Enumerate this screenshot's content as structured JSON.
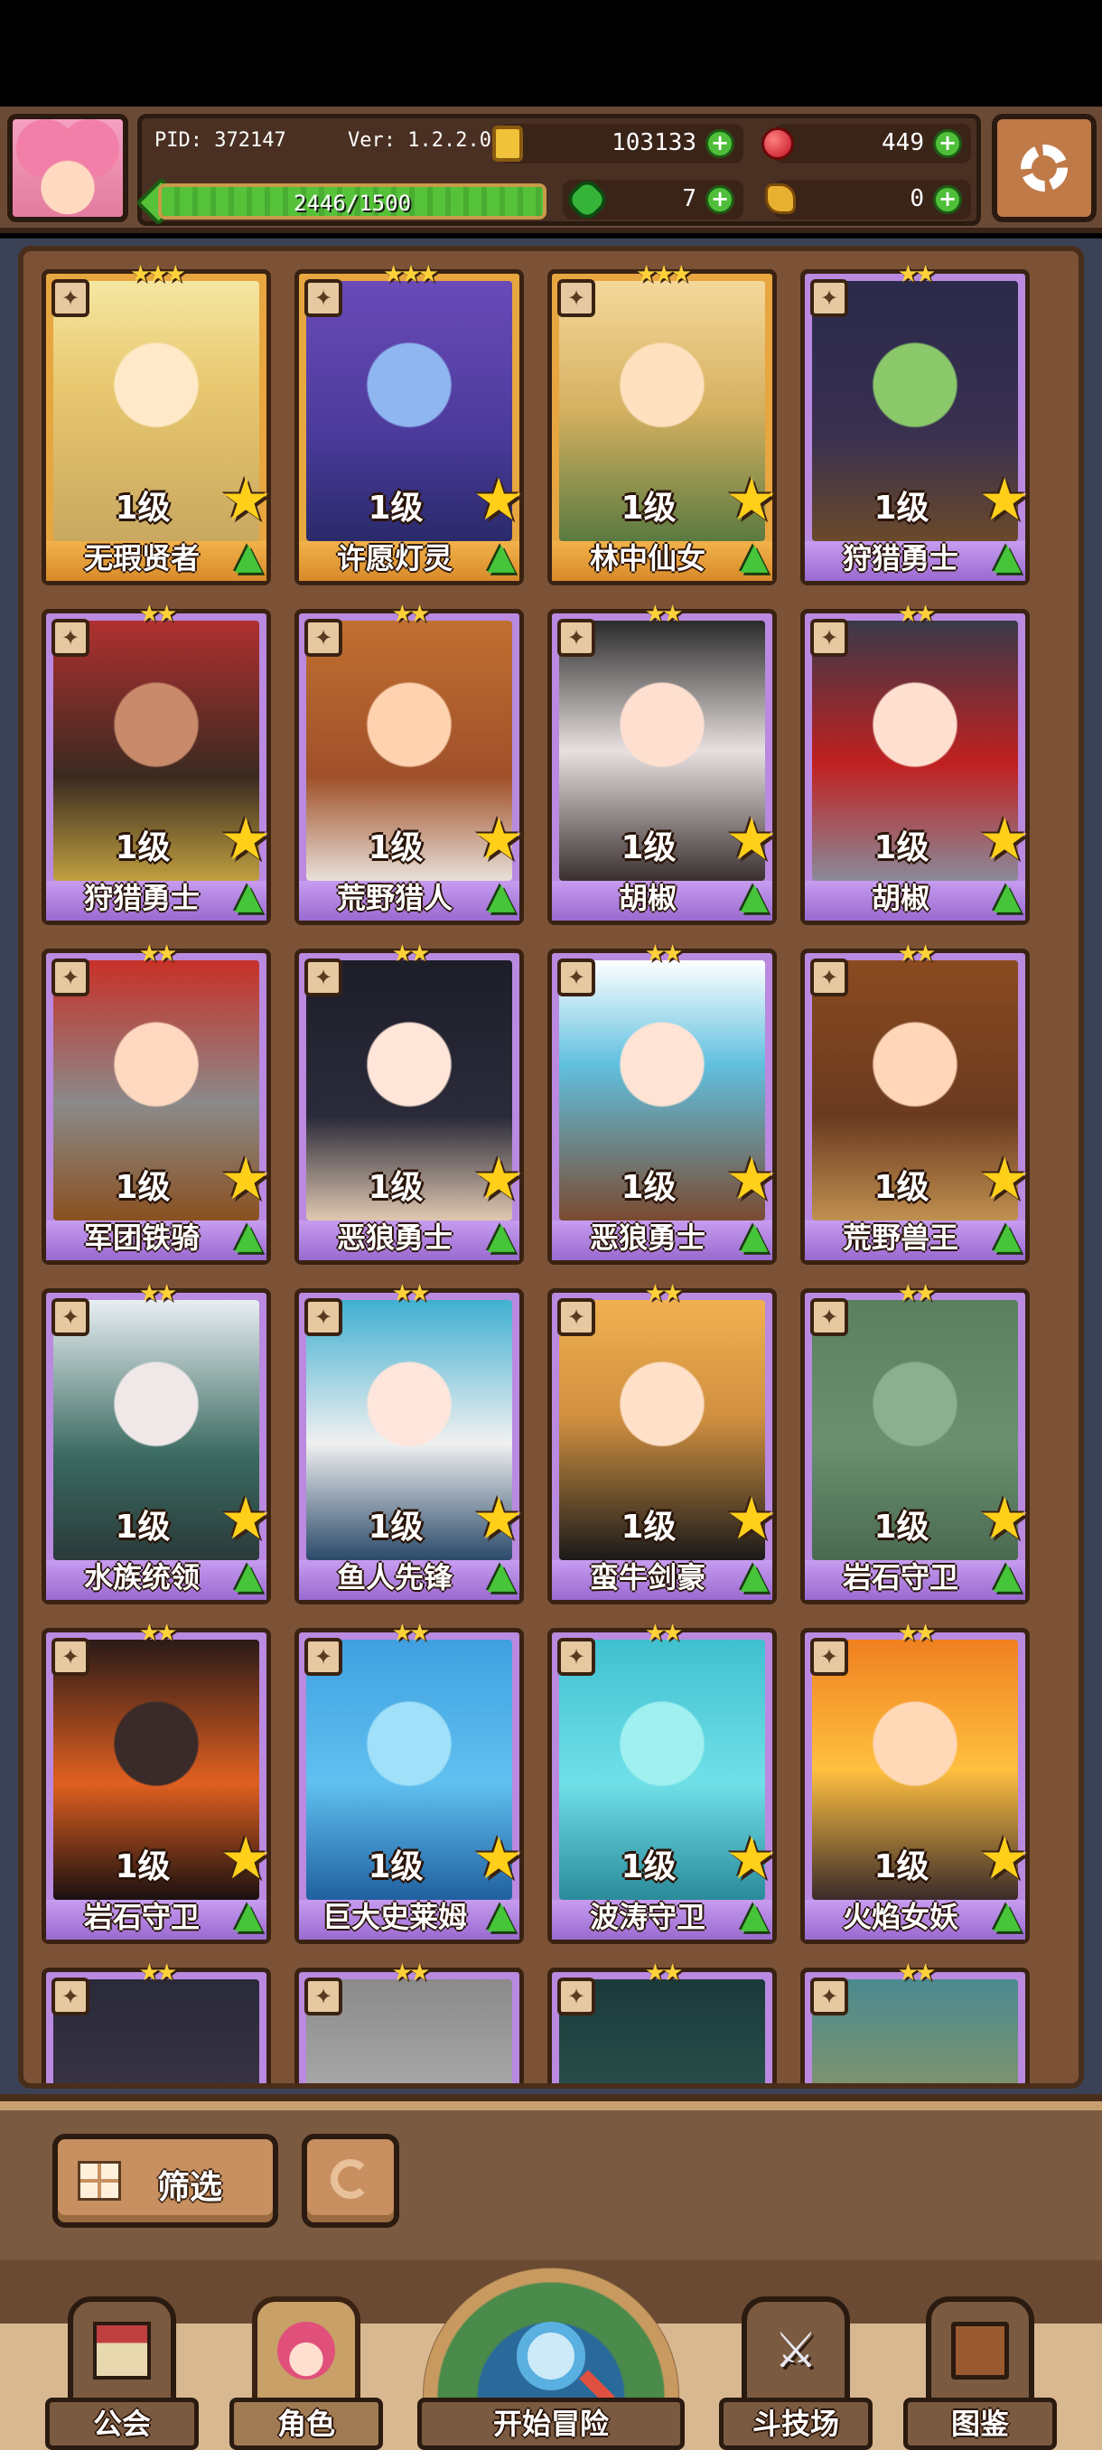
{
  "hud": {
    "pid": "PID: 372147",
    "version": "Ver: 1.2.2.0",
    "gold": "103133",
    "gems": "449",
    "clovers": "7",
    "keys": "0",
    "xp_text": "2446/1500",
    "xp_fraction": 1.0,
    "plus_label": "+"
  },
  "cards": [
    {
      "name": "无瑕贤者",
      "level": "1级",
      "stars": "★★★",
      "rarity": "gold"
    },
    {
      "name": "许愿灯灵",
      "level": "1级",
      "stars": "★★★",
      "rarity": "gold"
    },
    {
      "name": "林中仙女",
      "level": "1级",
      "stars": "★★★",
      "rarity": "gold"
    },
    {
      "name": "狩猎勇士",
      "level": "1级",
      "stars": "★★",
      "rarity": "purple"
    },
    {
      "name": "狩猎勇士",
      "level": "1级",
      "stars": "★★",
      "rarity": "purple"
    },
    {
      "name": "荒野猎人",
      "level": "1级",
      "stars": "★★",
      "rarity": "purple"
    },
    {
      "name": "胡椒",
      "level": "1级",
      "stars": "★★",
      "rarity": "purple"
    },
    {
      "name": "胡椒",
      "level": "1级",
      "stars": "★★",
      "rarity": "purple"
    },
    {
      "name": "军团铁骑",
      "level": "1级",
      "stars": "★★",
      "rarity": "purple"
    },
    {
      "name": "恶狼勇士",
      "level": "1级",
      "stars": "★★",
      "rarity": "purple"
    },
    {
      "name": "恶狼勇士",
      "level": "1级",
      "stars": "★★",
      "rarity": "purple"
    },
    {
      "name": "荒野兽王",
      "level": "1级",
      "stars": "★★",
      "rarity": "purple"
    },
    {
      "name": "水族统领",
      "level": "1级",
      "stars": "★★",
      "rarity": "purple"
    },
    {
      "name": "鱼人先锋",
      "level": "1级",
      "stars": "★★",
      "rarity": "purple"
    },
    {
      "name": "蛮牛剑豪",
      "level": "1级",
      "stars": "★★",
      "rarity": "purple"
    },
    {
      "name": "岩石守卫",
      "level": "1级",
      "stars": "★★",
      "rarity": "purple"
    },
    {
      "name": "岩石守卫",
      "level": "1级",
      "stars": "★★",
      "rarity": "purple"
    },
    {
      "name": "巨大史莱姆",
      "level": "1级",
      "stars": "★★",
      "rarity": "purple"
    },
    {
      "name": "波涛守卫",
      "level": "1级",
      "stars": "★★",
      "rarity": "purple"
    },
    {
      "name": "火焰女妖",
      "level": "1级",
      "stars": "★★",
      "rarity": "purple"
    },
    {
      "name": "",
      "level": "",
      "stars": "★★",
      "rarity": "purple"
    },
    {
      "name": "",
      "level": "",
      "stars": "★★",
      "rarity": "purple"
    },
    {
      "name": "",
      "level": "",
      "stars": "★★",
      "rarity": "purple"
    },
    {
      "name": "",
      "level": "",
      "stars": "★★",
      "rarity": "purple"
    }
  ],
  "card_glyphs": {
    "star": "★",
    "up": "▲",
    "class": "✦"
  },
  "controls": {
    "filter_label": "筛选"
  },
  "nav": {
    "guild": "公会",
    "characters": "角色",
    "adventure": "开始冒险",
    "arena": "斗技场",
    "codex": "图鉴"
  },
  "icons": {
    "guild": "guild-hall-icon",
    "characters": "character-face-icon",
    "adventure": "magnifier-icon",
    "arena": "crossed-swords-icon",
    "codex": "codex-book-icon"
  },
  "colors": {
    "gold_card": "#e7a640",
    "purple_card": "#b98ae0",
    "xp_green": "#56c23a"
  }
}
